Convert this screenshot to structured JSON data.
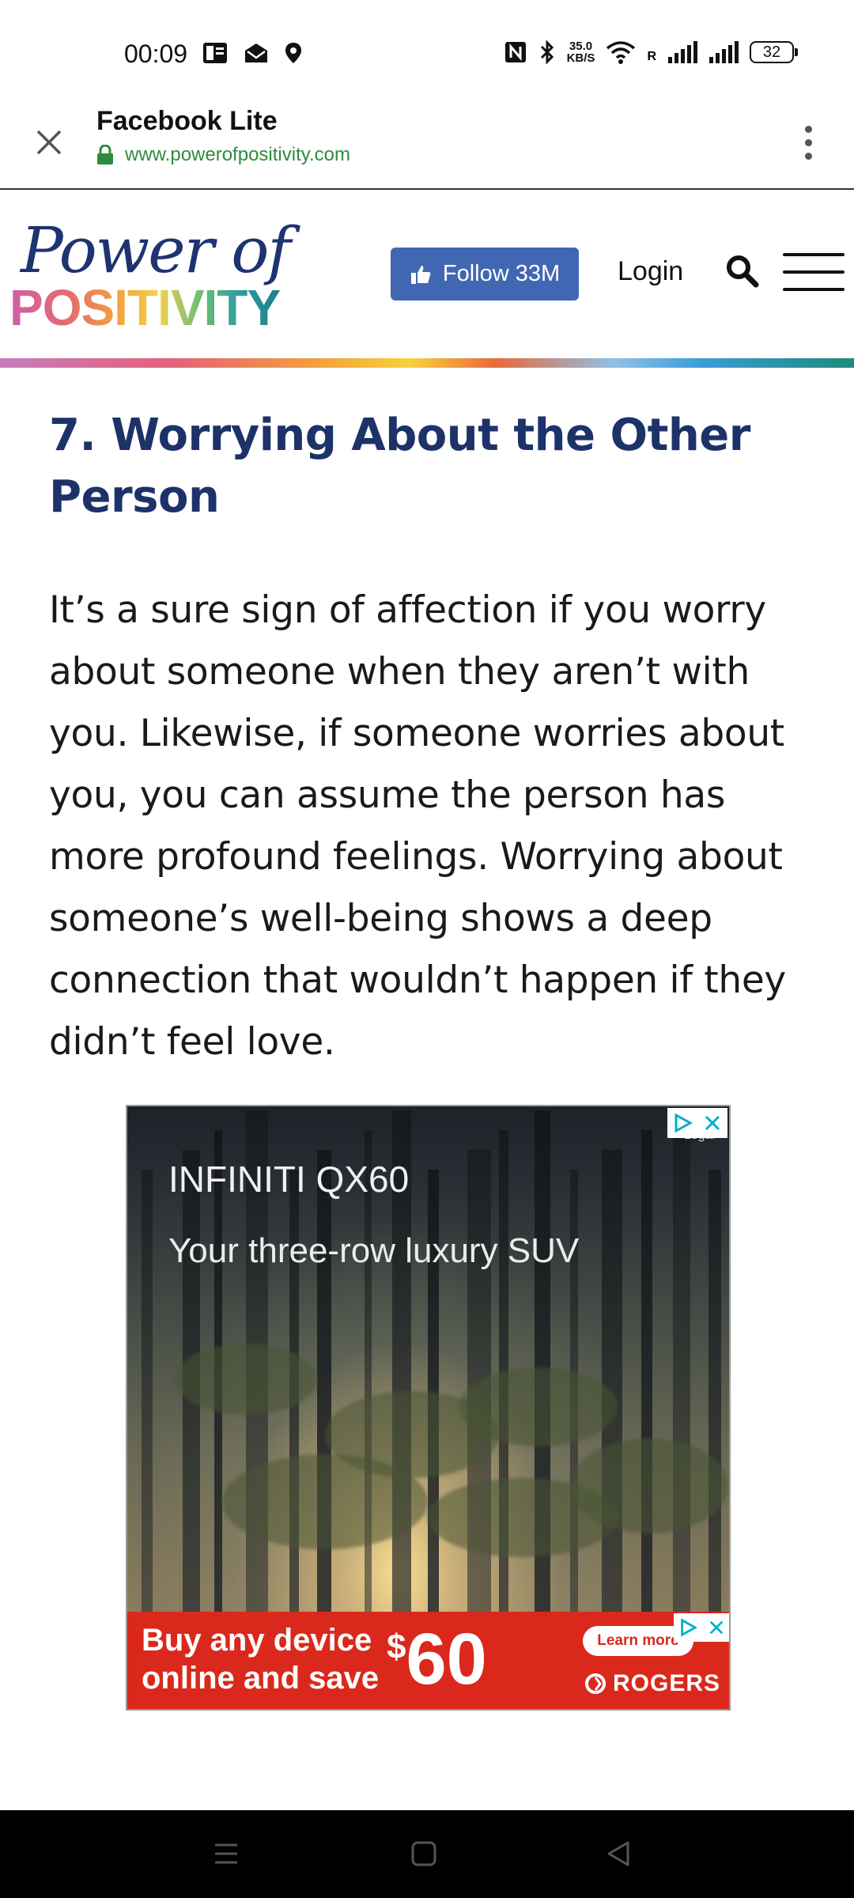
{
  "status_bar": {
    "time": "00:09",
    "net_speed_value": "35.0",
    "net_speed_unit": "KB/S",
    "roaming_label": "R",
    "battery_level": "32",
    "icons": [
      "news-icon",
      "mail-icon",
      "location-icon",
      "nfc-icon",
      "bluetooth-icon",
      "wifi-icon",
      "signal-icon",
      "signal-icon",
      "battery-icon"
    ]
  },
  "browser": {
    "title": "Facebook Lite",
    "url": "www.powerofpositivity.com",
    "icons": [
      "close-icon",
      "lock-icon",
      "more-options-icon"
    ]
  },
  "site_header": {
    "logo_top": "Power of",
    "logo_bottom": "POSITIVITY",
    "follow_label": "Follow 33M",
    "login_label": "Login",
    "icons": [
      "thumbs-up-icon",
      "search-icon",
      "hamburger-menu-icon"
    ]
  },
  "article": {
    "heading": "7. Worrying About the Other Person",
    "body": "It’s a sure sign of affection if you worry about someone when they aren’t with you. Likewise, if someone worries about you, you can assume the person has more profound feelings. Worrying about someone’s well-being shows a deep connection that wouldn’t happen if they didn’t feel love."
  },
  "ad": {
    "title": "INFINITI QX60",
    "subtitle": "Your three-row luxury SUV",
    "legal": "Legal",
    "banner_line1": "Buy any device",
    "banner_line2": "online and save",
    "banner_currency": "$",
    "banner_amount": "60",
    "learn_more": "Learn more",
    "brand": "ROGERS",
    "icons": [
      "adchoices-icon",
      "close-ad-icon"
    ]
  },
  "nav_bar": {
    "icons": [
      "recent-apps-icon",
      "home-icon",
      "back-icon"
    ]
  },
  "colors": {
    "heading": "#1c3269",
    "follow_button": "#4267b2",
    "url": "#2e8b3d",
    "ad_banner": "#da291c"
  }
}
